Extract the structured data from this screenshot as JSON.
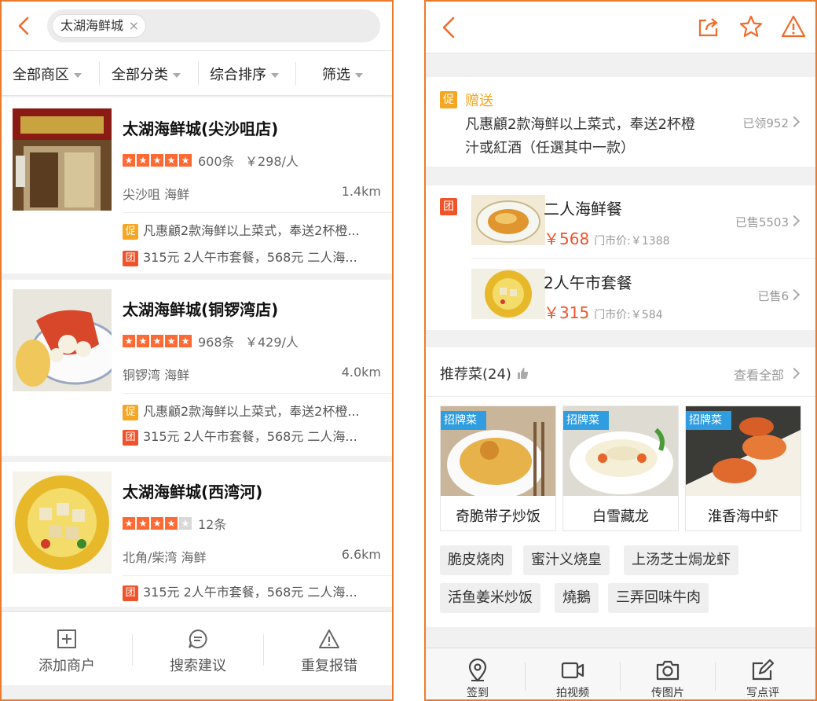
{
  "left": {
    "search_chip": "太湖海鲜城",
    "chip_close": "×",
    "filters": [
      "全部商区",
      "全部分类",
      "综合排序",
      "筛选"
    ],
    "tag_cu": "促",
    "tag_tuan": "团",
    "star_glyph": "★",
    "shops": [
      {
        "name": "太湖海鲜城(尖沙咀店)",
        "rating": 5,
        "reviews": "600条",
        "price": "￥298/人",
        "area": "尖沙咀 海鲜",
        "distance": "1.4km",
        "promo": "凡惠顧2款海鲜以上菜式，奉送2杯橙...",
        "deal": "315元 2人午市套餐，568元 二人海..."
      },
      {
        "name": "太湖海鲜城(铜锣湾店)",
        "rating": 5,
        "reviews": "968条",
        "price": "￥429/人",
        "area": "铜锣湾 海鲜",
        "distance": "4.0km",
        "promo": "凡惠顧2款海鲜以上菜式，奉送2杯橙...",
        "deal": "315元 2人午市套餐，568元 二人海..."
      },
      {
        "name": "太湖海鲜城(西湾河)",
        "rating": 4,
        "reviews": "12条",
        "price": "",
        "area": "北角/柴湾 海鲜",
        "distance": "6.6km",
        "promo": "",
        "deal": "315元 2人午市套餐，568元 二人海..."
      }
    ],
    "bottom_actions": [
      "添加商户",
      "搜索建议",
      "重复报错"
    ]
  },
  "right": {
    "promo": {
      "tag": "促",
      "title": "赠送",
      "line1": "凡惠顧2款海鲜以上菜式，奉送2杯橙",
      "line2": "汁或紅酒（任選其中一款）",
      "claimed": "已领952"
    },
    "deals_tag": "团",
    "deals": [
      {
        "name": "二人海鲜餐",
        "price": "￥568",
        "orig": "门市价:￥1388",
        "sold": "已售5503"
      },
      {
        "name": "2人午市套餐",
        "price": "￥315",
        "orig": "门市价:￥584",
        "sold": "已售6"
      }
    ],
    "recommend": {
      "title": "推荐菜(24)",
      "view_all": "查看全部",
      "badge": "招牌菜",
      "dishes": [
        "奇脆带子炒饭",
        "白雪藏龙",
        "淮香海中虾"
      ],
      "pills": [
        "脆皮烧肉",
        "蜜汁义烧皇",
        "上汤芝士焗龙虾",
        "活鱼姜米炒饭",
        "燒鵝",
        "三弄回味牛肉"
      ]
    },
    "bottom_actions": [
      "签到",
      "拍视频",
      "传图片",
      "写点评"
    ]
  },
  "colors": {
    "accent": "#f26a2a",
    "border": "#ec7a2c",
    "badge_blue": "#2f9de0"
  }
}
